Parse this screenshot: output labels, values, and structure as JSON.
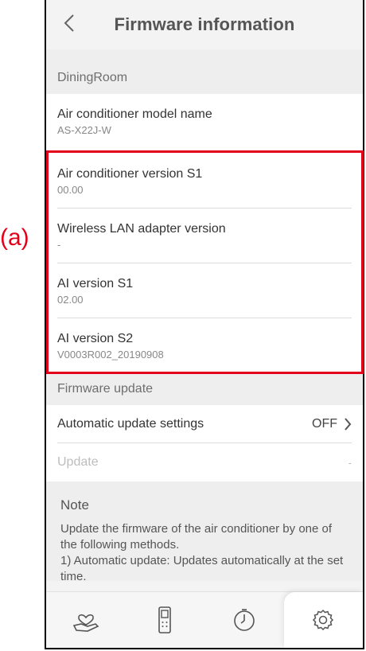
{
  "annotation": {
    "label": "(a)",
    "color": "#e3001b"
  },
  "header": {
    "title": "Firmware information",
    "back_icon": "chevron-left-icon"
  },
  "device_section": {
    "label": "DiningRoom"
  },
  "items": [
    {
      "label": "Air conditioner model name",
      "value": "AS-X22J-W"
    },
    {
      "label": "Air conditioner version S1",
      "value": "00.00"
    },
    {
      "label": "Wireless LAN adapter version",
      "value": "-"
    },
    {
      "label": "AI version S1",
      "value": "02.00"
    },
    {
      "label": "AI version S2",
      "value": "V0003R002_20190908"
    }
  ],
  "update_section": {
    "label": "Firmware update",
    "auto_update": {
      "label": "Automatic update settings",
      "value": "OFF"
    },
    "update": {
      "label": "Update",
      "value": "-"
    }
  },
  "note": {
    "title": "Note",
    "text": "Update the firmware of the air conditioner by one of the following methods.\n1) Automatic update: Updates automatically at the set time."
  },
  "tabs": [
    {
      "name": "care-tab",
      "icon": "hand-heart-icon"
    },
    {
      "name": "remote-tab",
      "icon": "remote-control-icon"
    },
    {
      "name": "timer-tab",
      "icon": "timer-icon"
    },
    {
      "name": "settings-tab",
      "icon": "gear-icon",
      "active": true
    }
  ]
}
